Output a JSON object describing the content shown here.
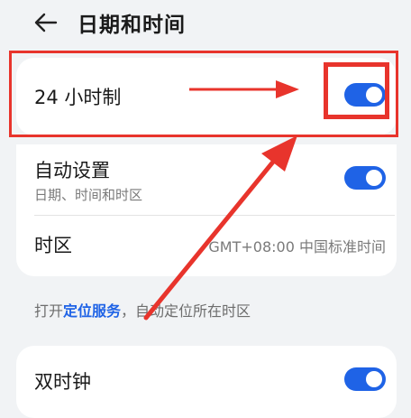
{
  "header": {
    "back_icon": "arrow-left-icon",
    "title": "日期和时间"
  },
  "settings": {
    "hour24": {
      "label": "24 小时制",
      "enabled": true
    },
    "auto_set": {
      "label": "自动设置",
      "sublabel": "日期、时间和时区",
      "enabled": true
    },
    "timezone": {
      "label": "时区",
      "value": "GMT+08:00 中国标准时间"
    },
    "footnote": {
      "prefix": "打开",
      "link": "定位服务",
      "suffix": "，自动定位所在时区"
    },
    "dual_clock": {
      "label": "双时钟",
      "enabled": true
    }
  },
  "colors": {
    "accent": "#1f63e6",
    "annotation": "#e8342c",
    "background": "#f1f3f5"
  }
}
